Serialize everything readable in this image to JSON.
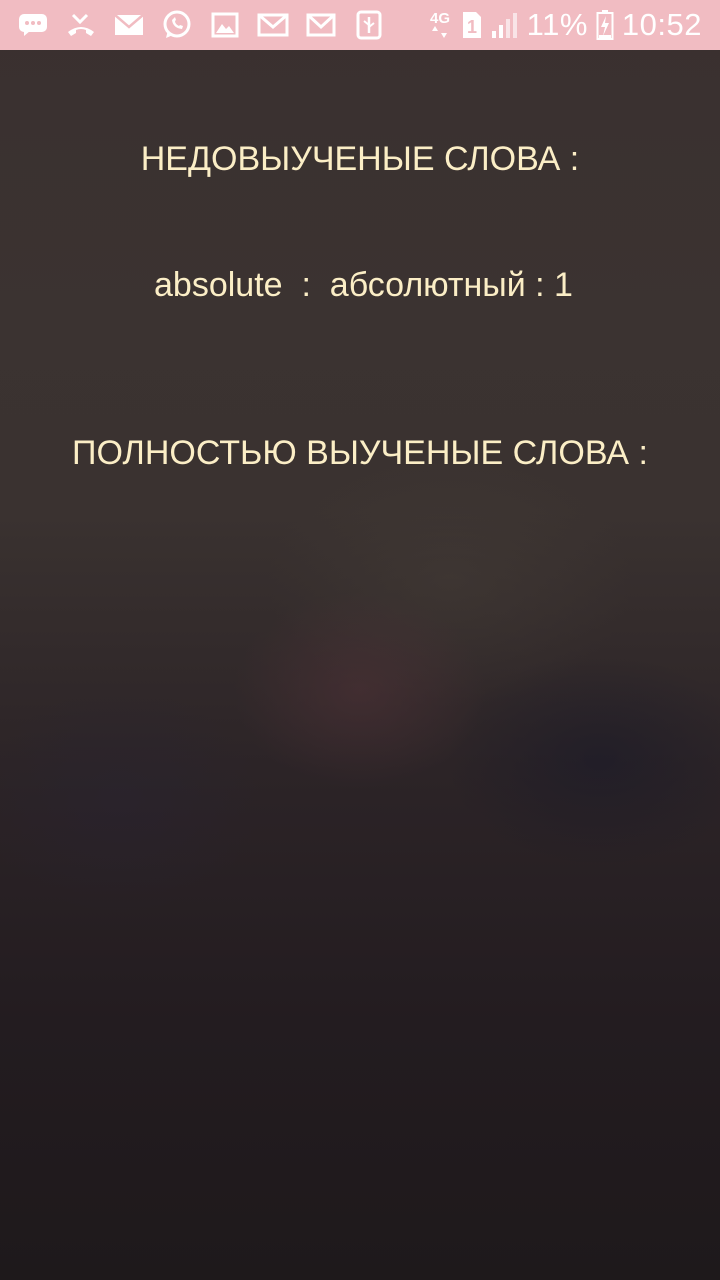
{
  "status_bar": {
    "icons": [
      "messages-icon",
      "missed-call-icon",
      "mail-icon",
      "whatsapp-icon",
      "gallery-icon",
      "gmail-icon",
      "gmail-icon",
      "usb-icon"
    ],
    "network_label": "4G",
    "sim_label": "1",
    "battery_percent": "11%",
    "time": "10:52",
    "background_color": "#f1bcc2"
  },
  "main": {
    "unlearned_heading": "НЕДОВЫУЧЕНЫЕ СЛОВА :",
    "unlearned_words": [
      {
        "word": "absolute",
        "translation": "абсолютный",
        "count": "1"
      }
    ],
    "learned_heading": "ПОЛНОСТЬЮ ВЫУЧЕНЫЕ СЛОВА :",
    "text_color": "#fbeec6"
  }
}
